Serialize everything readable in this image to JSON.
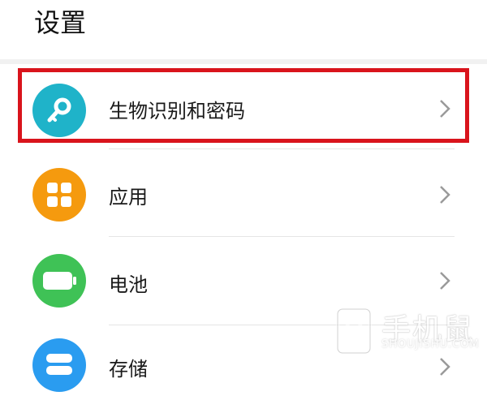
{
  "header": {
    "title": "设置"
  },
  "colors": {
    "key_icon_bg": "#1fb3c9",
    "apps_icon_bg": "#f59a0e",
    "battery_icon_bg": "#3fc256",
    "storage_icon_bg": "#2a9cf0",
    "highlight_border": "#d9141c"
  },
  "settings": {
    "items": [
      {
        "label": "生物识别和密码",
        "icon": "key-icon"
      },
      {
        "label": "应用",
        "icon": "apps-grid-icon"
      },
      {
        "label": "电池",
        "icon": "battery-icon"
      },
      {
        "label": "存储",
        "icon": "storage-icon"
      }
    ]
  },
  "watermark": {
    "main": "手机鼠",
    "sub": "SHOUJISHU.COM"
  }
}
